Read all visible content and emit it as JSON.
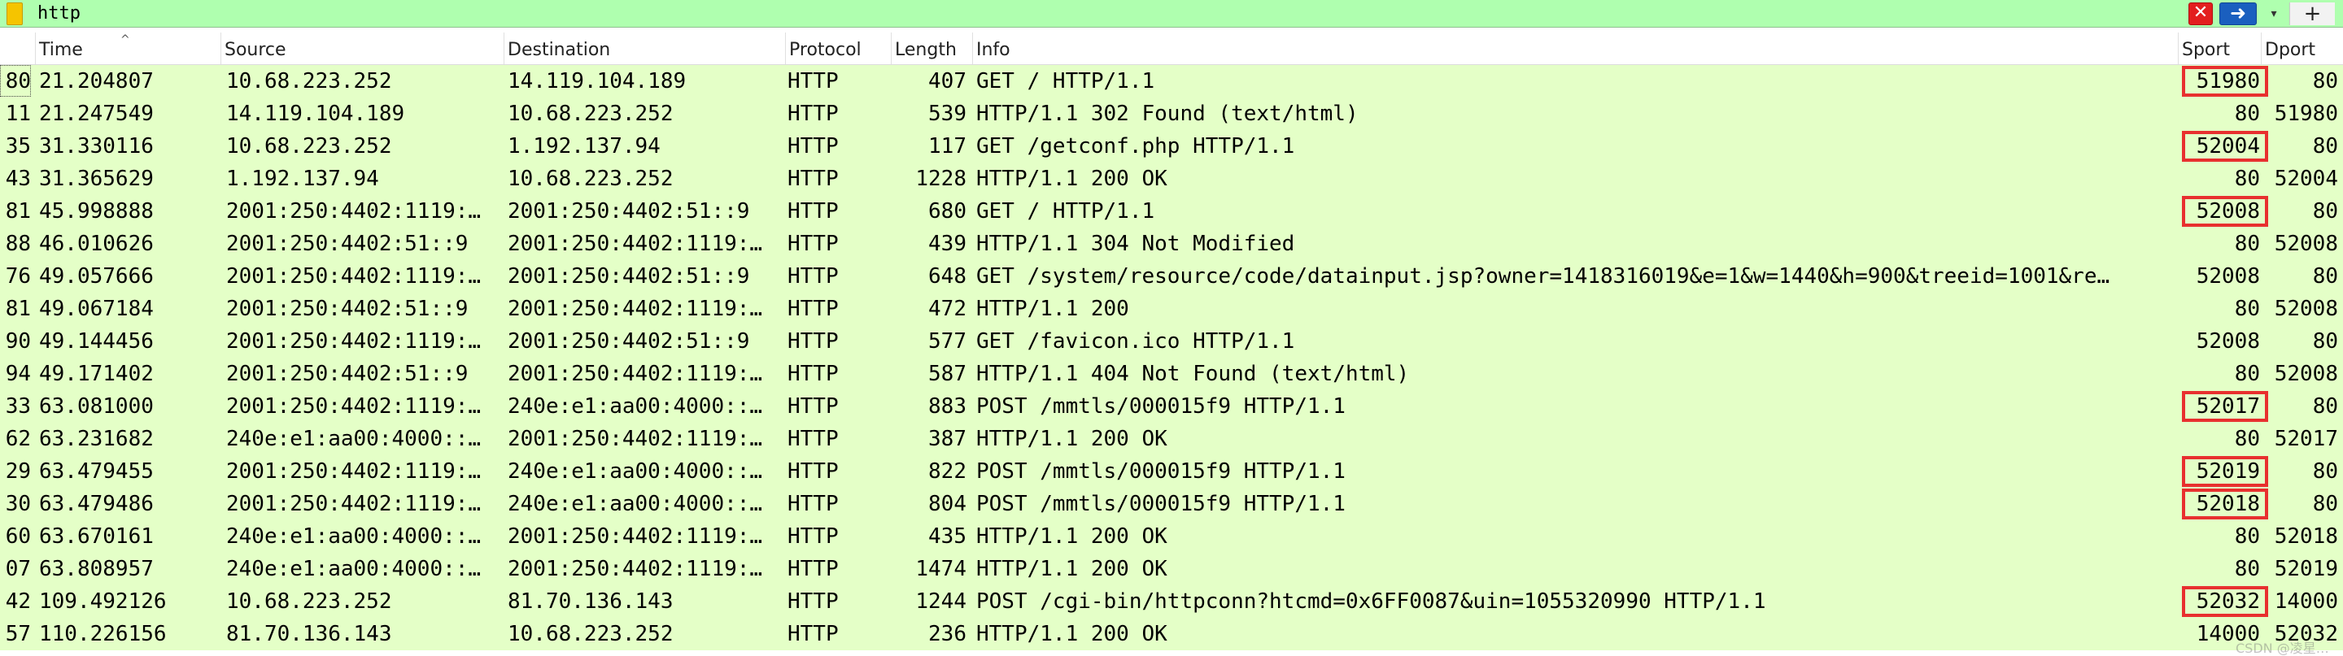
{
  "filter": {
    "value": "http",
    "clear_icon": "✕",
    "apply_icon": "➜",
    "recent_icon": "▾",
    "add_icon": "+",
    "colors": {
      "background": "#afffaf",
      "clear": "#e31e1e",
      "apply": "#1a5fbf"
    }
  },
  "columns": {
    "time": "Time",
    "source": "Source",
    "destination": "Destination",
    "protocol": "Protocol",
    "length": "Length",
    "info": "Info",
    "sport": "Sport",
    "dport": "Dport",
    "sort_indicator": "^"
  },
  "rows": [
    {
      "no": "80",
      "time": "21.204807",
      "source": "10.68.223.252",
      "destination": "14.119.104.189",
      "protocol": "HTTP",
      "length": "407",
      "info": "GET / HTTP/1.1",
      "sport": "51980",
      "dport": "80",
      "highlight": true
    },
    {
      "no": "11",
      "time": "21.247549",
      "source": "14.119.104.189",
      "destination": "10.68.223.252",
      "protocol": "HTTP",
      "length": "539",
      "info": "HTTP/1.1 302 Found  (text/html)",
      "sport": "80",
      "dport": "51980",
      "highlight": false
    },
    {
      "no": "35",
      "time": "31.330116",
      "source": "10.68.223.252",
      "destination": "1.192.137.94",
      "protocol": "HTTP",
      "length": "117",
      "info": "GET /getconf.php HTTP/1.1",
      "sport": "52004",
      "dport": "80",
      "highlight": true
    },
    {
      "no": "43",
      "time": "31.365629",
      "source": "1.192.137.94",
      "destination": "10.68.223.252",
      "protocol": "HTTP",
      "length": "1228",
      "info": "HTTP/1.1 200 OK",
      "sport": "80",
      "dport": "52004",
      "highlight": false
    },
    {
      "no": "81",
      "time": "45.998888",
      "source": "2001:250:4402:1119:…",
      "destination": "2001:250:4402:51::9",
      "protocol": "HTTP",
      "length": "680",
      "info": "GET / HTTP/1.1",
      "sport": "52008",
      "dport": "80",
      "highlight": true
    },
    {
      "no": "88",
      "time": "46.010626",
      "source": "2001:250:4402:51::9",
      "destination": "2001:250:4402:1119:…",
      "protocol": "HTTP",
      "length": "439",
      "info": "HTTP/1.1 304 Not Modified",
      "sport": "80",
      "dport": "52008",
      "highlight": false
    },
    {
      "no": "76",
      "time": "49.057666",
      "source": "2001:250:4402:1119:…",
      "destination": "2001:250:4402:51::9",
      "protocol": "HTTP",
      "length": "648",
      "info": "GET /system/resource/code/datainput.jsp?owner=1418316019&e=1&w=1440&h=900&treeid=1001&re…",
      "sport": "52008",
      "dport": "80",
      "highlight": false
    },
    {
      "no": "81",
      "time": "49.067184",
      "source": "2001:250:4402:51::9",
      "destination": "2001:250:4402:1119:…",
      "protocol": "HTTP",
      "length": "472",
      "info": "HTTP/1.1 200",
      "sport": "80",
      "dport": "52008",
      "highlight": false
    },
    {
      "no": "90",
      "time": "49.144456",
      "source": "2001:250:4402:1119:…",
      "destination": "2001:250:4402:51::9",
      "protocol": "HTTP",
      "length": "577",
      "info": "GET /favicon.ico HTTP/1.1",
      "sport": "52008",
      "dport": "80",
      "highlight": false
    },
    {
      "no": "94",
      "time": "49.171402",
      "source": "2001:250:4402:51::9",
      "destination": "2001:250:4402:1119:…",
      "protocol": "HTTP",
      "length": "587",
      "info": "HTTP/1.1 404 Not Found  (text/html)",
      "sport": "80",
      "dport": "52008",
      "highlight": false
    },
    {
      "no": "33",
      "time": "63.081000",
      "source": "2001:250:4402:1119:…",
      "destination": "240e:e1:aa00:4000::…",
      "protocol": "HTTP",
      "length": "883",
      "info": "POST /mmtls/000015f9 HTTP/1.1",
      "sport": "52017",
      "dport": "80",
      "highlight": true
    },
    {
      "no": "62",
      "time": "63.231682",
      "source": "240e:e1:aa00:4000::…",
      "destination": "2001:250:4402:1119:…",
      "protocol": "HTTP",
      "length": "387",
      "info": "HTTP/1.1 200 OK",
      "sport": "80",
      "dport": "52017",
      "highlight": false
    },
    {
      "no": "29",
      "time": "63.479455",
      "source": "2001:250:4402:1119:…",
      "destination": "240e:e1:aa00:4000::…",
      "protocol": "HTTP",
      "length": "822",
      "info": "POST /mmtls/000015f9 HTTP/1.1",
      "sport": "52019",
      "dport": "80",
      "highlight": true
    },
    {
      "no": "30",
      "time": "63.479486",
      "source": "2001:250:4402:1119:…",
      "destination": "240e:e1:aa00:4000::…",
      "protocol": "HTTP",
      "length": "804",
      "info": "POST /mmtls/000015f9 HTTP/1.1",
      "sport": "52018",
      "dport": "80",
      "highlight": true
    },
    {
      "no": "60",
      "time": "63.670161",
      "source": "240e:e1:aa00:4000::…",
      "destination": "2001:250:4402:1119:…",
      "protocol": "HTTP",
      "length": "435",
      "info": "HTTP/1.1 200 OK",
      "sport": "80",
      "dport": "52018",
      "highlight": false
    },
    {
      "no": "07",
      "time": "63.808957",
      "source": "240e:e1:aa00:4000::…",
      "destination": "2001:250:4402:1119:…",
      "protocol": "HTTP",
      "length": "1474",
      "info": "HTTP/1.1 200 OK",
      "sport": "80",
      "dport": "52019",
      "highlight": false
    },
    {
      "no": "42",
      "time": "109.492126",
      "source": "10.68.223.252",
      "destination": "81.70.136.143",
      "protocol": "HTTP",
      "length": "1244",
      "info": "POST /cgi-bin/httpconn?htcmd=0x6FF0087&uin=1055320990 HTTP/1.1",
      "sport": "52032",
      "dport": "14000",
      "highlight": true
    },
    {
      "no": "57",
      "time": "110.226156",
      "source": "81.70.136.143",
      "destination": "10.68.223.252",
      "protocol": "HTTP",
      "length": "236",
      "info": "HTTP/1.1 200 OK",
      "sport": "14000",
      "dport": "52032",
      "highlight": false
    }
  ],
  "watermark": "CSDN @凌星…",
  "colors": {
    "row_background": "#e4ffc7",
    "highlight_box": "#e8302f"
  }
}
